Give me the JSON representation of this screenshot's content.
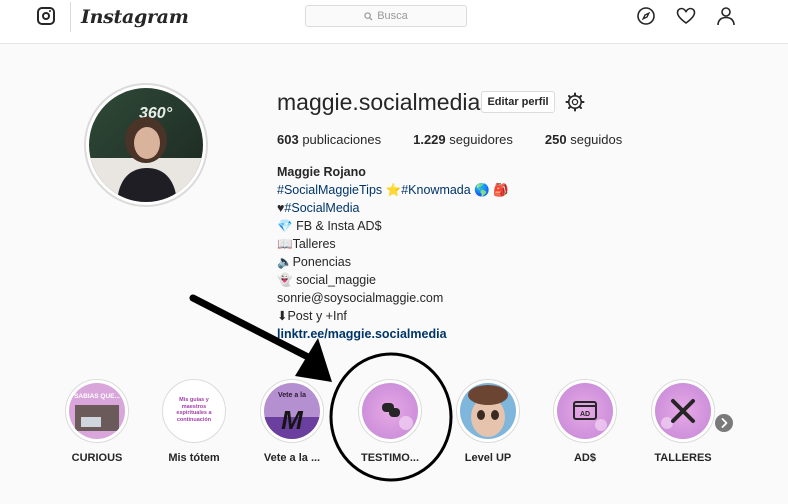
{
  "nav": {
    "brand": "Instagram",
    "search_placeholder": "Busca",
    "icons": [
      "instagram-glyph-icon",
      "compass-icon",
      "heart-icon",
      "user-icon"
    ]
  },
  "profile": {
    "username": "maggie.socialmedia",
    "edit_label": "Editar perfil",
    "stats": {
      "posts_count": "603",
      "posts_label": "publicaciones",
      "followers_count": "1.229",
      "followers_label": "seguidores",
      "following_count": "250",
      "following_label": "seguidos"
    },
    "bio": {
      "name": "Maggie Rojano",
      "line1_tag1": "#SocialMaggieTips",
      "line1_tag2": "#Knowmada",
      "line2_prefix": "♥",
      "line2_tag": "#SocialMedia",
      "line3": "FB & Insta AD$",
      "line4": "Talleres",
      "line5": "Ponencias",
      "line6": "social_maggie",
      "line7": "sonrie@soysocialmaggie.com",
      "line8": "⬇Post y +Inf",
      "link": "linktr.ee/maggie.socialmedia"
    },
    "avatar_text": "360°"
  },
  "highlights": [
    {
      "label": "CURIOUS",
      "cover_text": "SABIAS QUE..."
    },
    {
      "label": "Mis tótem",
      "cover_text": "Mis guías y maestros espirituales a continuación"
    },
    {
      "label": "Vete a la ...",
      "cover_text": "Vete a la"
    },
    {
      "label": "TESTIMO...",
      "cover_text": ""
    },
    {
      "label": "Level UP",
      "cover_text": ""
    },
    {
      "label": "AD$",
      "cover_text": ""
    },
    {
      "label": "TALLERES",
      "cover_text": ""
    }
  ],
  "colors": {
    "link": "#003569",
    "border": "#dbdbdb",
    "background": "#fafafa",
    "highlight_pink": "#d9a0e0"
  }
}
